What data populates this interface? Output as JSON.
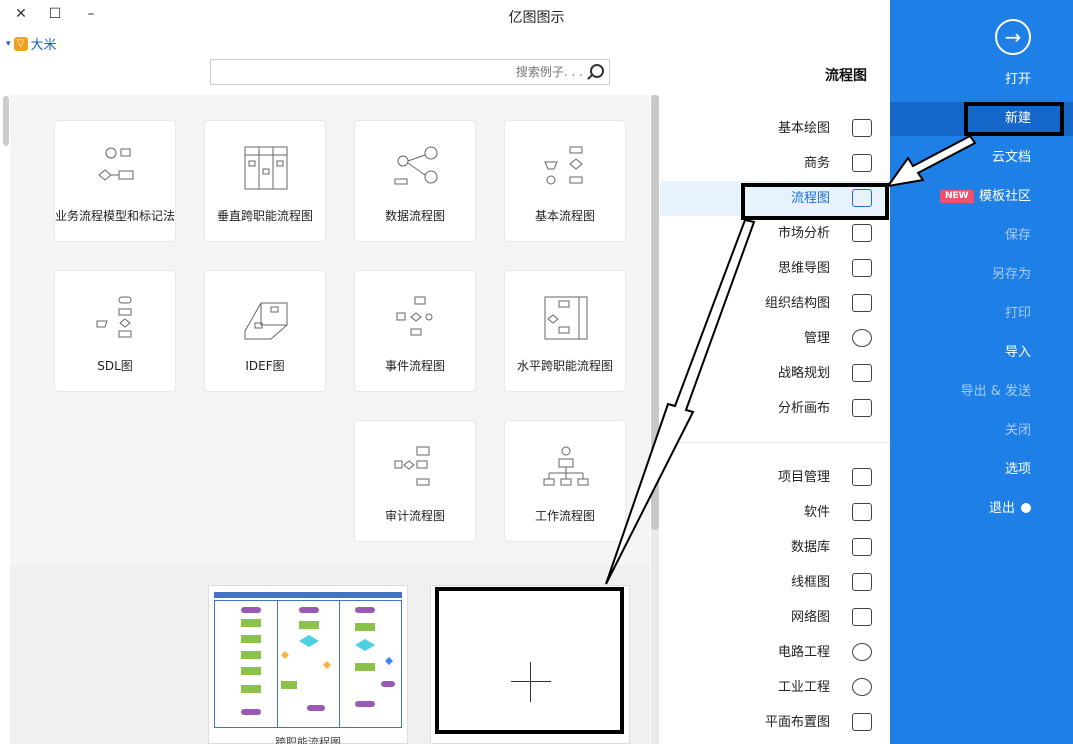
{
  "window": {
    "title": "亿图图示",
    "close": "✕",
    "maximize": "☐",
    "minimize": "–"
  },
  "user": {
    "name": "大米",
    "arrow": "▾"
  },
  "sidebar": {
    "items": [
      {
        "label": "打开"
      },
      {
        "label": "新建"
      },
      {
        "label": "云文档"
      },
      {
        "label": "模板社区",
        "badge": "NEW"
      },
      {
        "label": "保存"
      },
      {
        "label": "另存为"
      },
      {
        "label": "打印"
      },
      {
        "label": "导入"
      },
      {
        "label": "导出 & 发送"
      },
      {
        "label": "关闭"
      },
      {
        "label": "选项"
      },
      {
        "label": "退出"
      }
    ]
  },
  "section_title": "流程图",
  "search": {
    "placeholder": "搜索例子. . ."
  },
  "categories": [
    {
      "label": "基本绘图",
      "icon": "shapes-icon"
    },
    {
      "label": "商务",
      "icon": "briefcase-icon"
    },
    {
      "label": "流程图",
      "icon": "flowchart-icon"
    },
    {
      "label": "市场分析",
      "icon": "bar-chart-icon"
    },
    {
      "label": "思维导图",
      "icon": "mindmap-icon"
    },
    {
      "label": "组织结构图",
      "icon": "org-chart-icon"
    },
    {
      "label": "管理",
      "icon": "gear-icon"
    },
    {
      "label": "战略规划",
      "icon": "strategy-icon"
    },
    {
      "label": "分析画布",
      "icon": "canvas-icon"
    },
    {
      "label": "项目管理",
      "icon": "gantt-icon"
    },
    {
      "label": "软件",
      "icon": "software-icon"
    },
    {
      "label": "数据库",
      "icon": "database-icon"
    },
    {
      "label": "线框图",
      "icon": "wireframe-icon"
    },
    {
      "label": "网络图",
      "icon": "network-icon"
    },
    {
      "label": "电路工程",
      "icon": "circuit-icon"
    },
    {
      "label": "工业工程",
      "icon": "industrial-icon"
    },
    {
      "label": "平面布置图",
      "icon": "floorplan-icon"
    }
  ],
  "templates": [
    {
      "label": "基本流程图"
    },
    {
      "label": "数据流程图"
    },
    {
      "label": "垂直跨职能流程图"
    },
    {
      "label": "业务流程模型和标记法"
    },
    {
      "label": "水平跨职能流程图"
    },
    {
      "label": "事件流程图"
    },
    {
      "label": "IDEF图"
    },
    {
      "label": "SDL图"
    },
    {
      "label": "工作流程图"
    },
    {
      "label": "审计流程图"
    }
  ],
  "recent": {
    "caption": "跨职能流程图"
  },
  "blank_plus": "+"
}
